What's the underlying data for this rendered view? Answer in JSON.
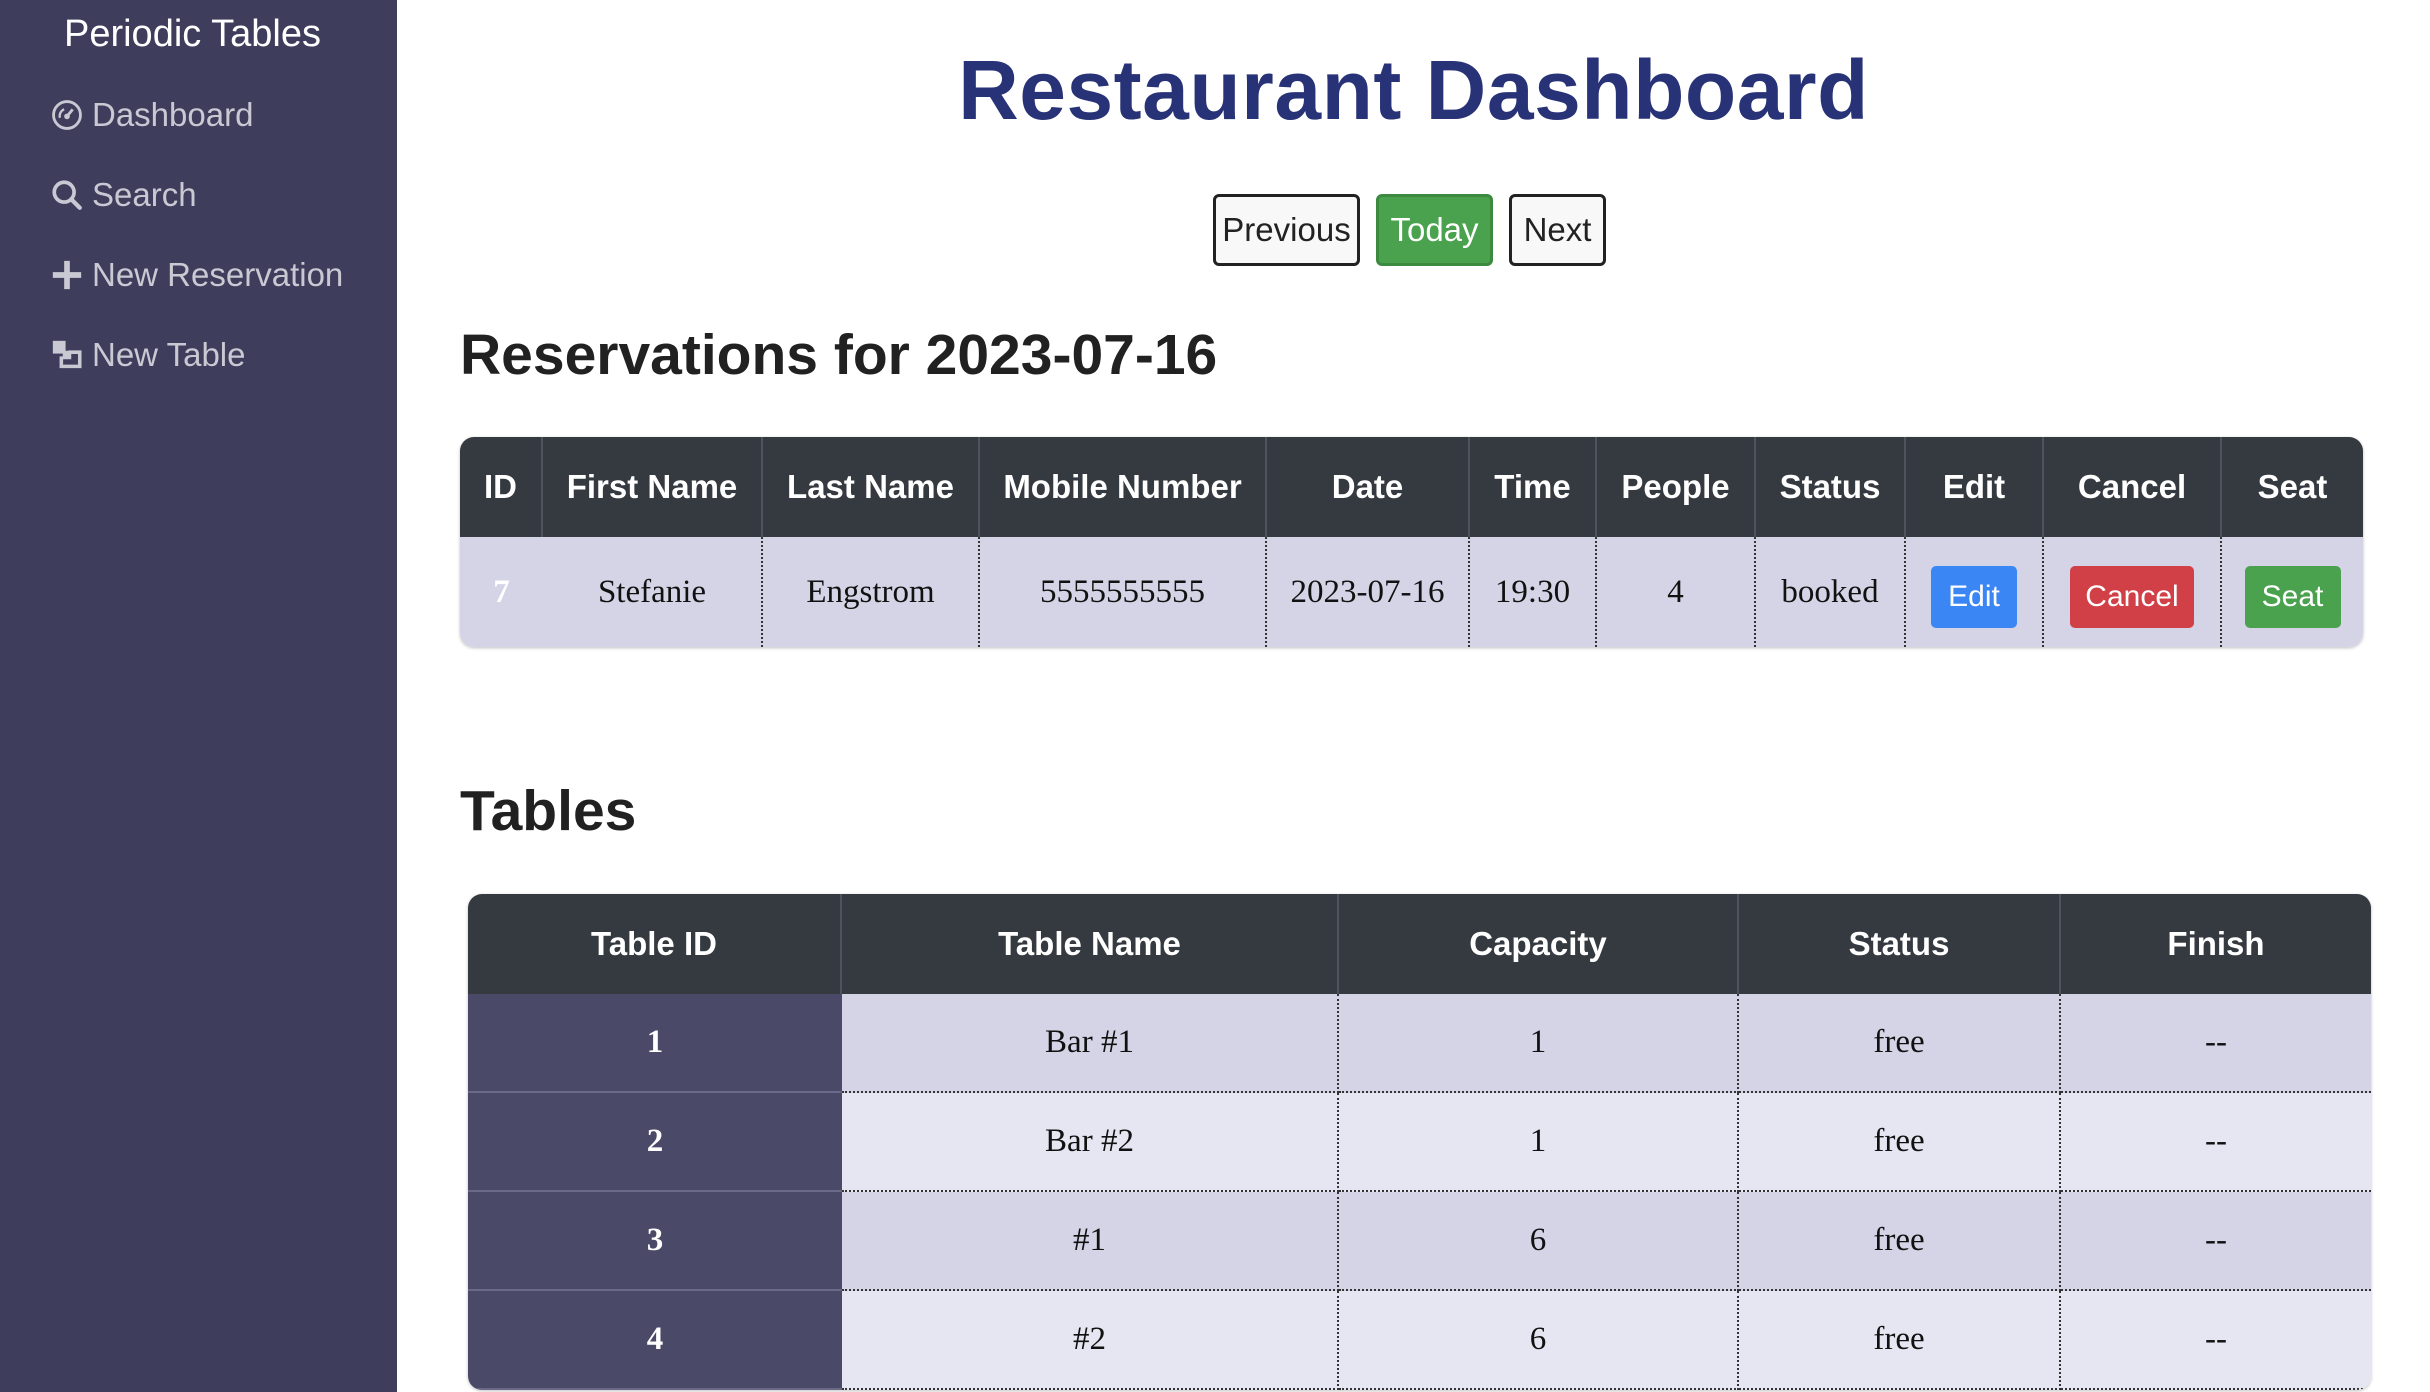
{
  "sidebar": {
    "brand": "Periodic Tables",
    "items": [
      {
        "label": "Dashboard",
        "icon": "dashboard-icon"
      },
      {
        "label": "Search",
        "icon": "search-icon"
      },
      {
        "label": "New Reservation",
        "icon": "plus-icon"
      },
      {
        "label": "New Table",
        "icon": "layers-icon"
      }
    ]
  },
  "header": {
    "title": "Restaurant Dashboard",
    "buttons": {
      "previous": "Previous",
      "today": "Today",
      "next": "Next"
    }
  },
  "reservations": {
    "title": "Reservations for 2023-07-16",
    "columns": [
      "ID",
      "First Name",
      "Last Name",
      "Mobile Number",
      "Date",
      "Time",
      "People",
      "Status",
      "Edit",
      "Cancel",
      "Seat"
    ],
    "rows": [
      {
        "id": "7",
        "first_name": "Stefanie",
        "last_name": "Engstrom",
        "mobile": "5555555555",
        "date": "2023-07-16",
        "time": "19:30",
        "people": "4",
        "status": "booked",
        "edit": "Edit",
        "cancel": "Cancel",
        "seat": "Seat"
      }
    ]
  },
  "tables": {
    "title": "Tables",
    "columns": [
      "Table ID",
      "Table Name",
      "Capacity",
      "Status",
      "Finish"
    ],
    "rows": [
      {
        "id": "1",
        "name": "Bar #1",
        "capacity": "1",
        "status": "free",
        "finish": "--"
      },
      {
        "id": "2",
        "name": "Bar #2",
        "capacity": "1",
        "status": "free",
        "finish": "--"
      },
      {
        "id": "3",
        "name": "#1",
        "capacity": "6",
        "status": "free",
        "finish": "--"
      },
      {
        "id": "4",
        "name": "#2",
        "capacity": "6",
        "status": "free",
        "finish": "--"
      }
    ]
  },
  "colors": {
    "sidebar_bg": "#3e3d5c",
    "title": "#283276",
    "table_header": "#343a40",
    "edit": "#3a86f5",
    "cancel": "#d13f47",
    "success": "#4aa24e"
  }
}
